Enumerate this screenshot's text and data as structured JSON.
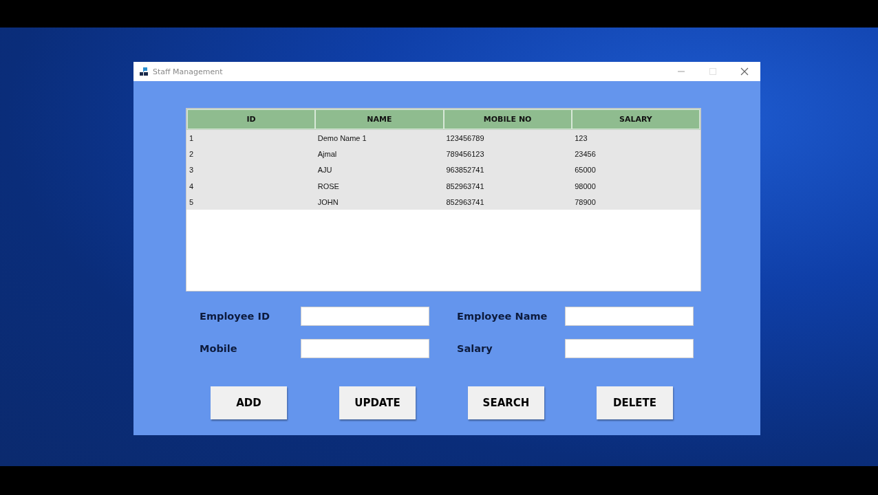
{
  "window": {
    "title": "Staff Management"
  },
  "table": {
    "columns": [
      "ID",
      "NAME",
      "MOBILE NO",
      "SALARY"
    ],
    "rows": [
      [
        "1",
        "Demo Name 1",
        "123456789",
        "123"
      ],
      [
        "2",
        "Ajmal",
        "789456123",
        "23456"
      ],
      [
        "3",
        "AJU",
        "963852741",
        "65000"
      ],
      [
        "4",
        "ROSE",
        "852963741",
        "98000"
      ],
      [
        "5",
        "JOHN",
        "852963741",
        "78900"
      ]
    ]
  },
  "form": {
    "fields": [
      {
        "label": "Employee ID"
      },
      {
        "label": "Employee Name"
      },
      {
        "label": "Mobile"
      },
      {
        "label": "Salary"
      }
    ]
  },
  "buttons": [
    "ADD",
    "UPDATE",
    "SEARCH",
    "DELETE"
  ]
}
